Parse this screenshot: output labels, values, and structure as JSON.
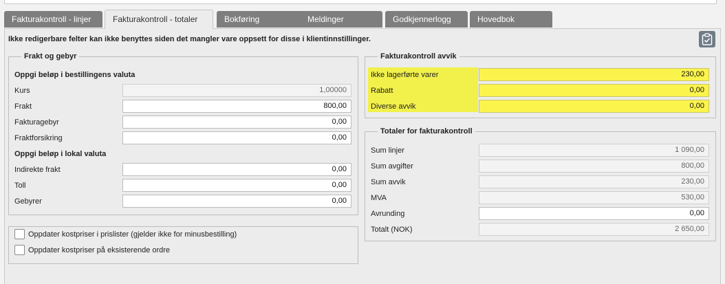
{
  "tabs": [
    {
      "label": "Fakturakontroll - linjer"
    },
    {
      "label": "Fakturakontroll - totaler"
    },
    {
      "label": "Bokføring"
    },
    {
      "label": "Meldinger"
    },
    {
      "label": "Godkjennerlogg"
    },
    {
      "label": "Hovedbok"
    }
  ],
  "active_tab": "Fakturakontroll - totaler",
  "notice": "Ikke redigerbare felter kan ikke benyttes siden det mangler vare oppsett for disse i klientinnstillinger.",
  "clipboard_icon": "clipboard-check-icon",
  "freight": {
    "legend": "Frakt og gebyr",
    "order_currency_heading": "Oppgi beløp i bestillingens valuta",
    "local_currency_heading": "Oppgi beløp i lokal valuta",
    "fields": {
      "kurs": {
        "label": "Kurs",
        "value": "1,00000"
      },
      "frakt": {
        "label": "Frakt",
        "value": "800,00"
      },
      "fakturagebyr": {
        "label": "Fakturagebyr",
        "value": "0,00"
      },
      "fraktforsikring": {
        "label": "Fraktforsikring",
        "value": "0,00"
      },
      "indirekte_frakt": {
        "label": "Indirekte frakt",
        "value": "0,00"
      },
      "toll": {
        "label": "Toll",
        "value": "0,00"
      },
      "gebyrer": {
        "label": "Gebyrer",
        "value": "0,00"
      }
    }
  },
  "options": {
    "update_price_lists": {
      "label": "Oppdater kostpriser i prislister (gjelder ikke for minusbestilling)",
      "checked": false
    },
    "update_existing_orders": {
      "label": "Oppdater kostpriser på eksisterende ordre",
      "checked": false
    }
  },
  "deviations": {
    "legend": "Fakturakontroll avvik",
    "highlight_color": "#f2f04a",
    "fields": {
      "ikke_lagerforte": {
        "label": "Ikke lagerførte varer",
        "value": "230,00"
      },
      "rabatt": {
        "label": "Rabatt",
        "value": "0,00"
      },
      "diverse_avvik": {
        "label": "Diverse avvik",
        "value": "0,00"
      }
    }
  },
  "totals": {
    "legend": "Totaler for fakturakontroll",
    "fields": {
      "sum_linjer": {
        "label": "Sum linjer",
        "value": "1 090,00"
      },
      "sum_avgifter": {
        "label": "Sum avgifter",
        "value": "800,00"
      },
      "sum_avvik": {
        "label": "Sum avvik",
        "value": "230,00"
      },
      "mva": {
        "label": "MVA",
        "value": "530,00"
      },
      "avrunding": {
        "label": "Avrunding",
        "value": "0,00"
      },
      "totalt": {
        "label": "Totalt (NOK)",
        "value": "2 650,00"
      }
    }
  },
  "colors": {
    "tab_inactive": "#7e7e7e",
    "panel_bg": "#ececec",
    "readonly_bg": "#f3f3f3",
    "highlight": "#f2f04a"
  }
}
